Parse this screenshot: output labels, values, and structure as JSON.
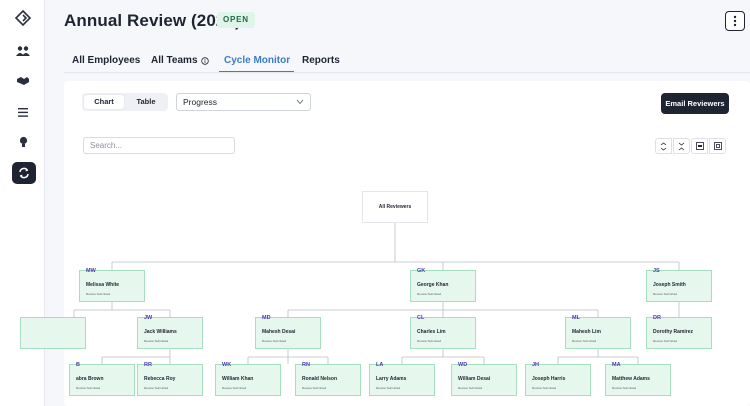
{
  "rail": {
    "items": [
      {
        "name": "logo-icon"
      },
      {
        "name": "people-icon"
      },
      {
        "name": "handshake-icon"
      },
      {
        "name": "list-icon"
      },
      {
        "name": "lightbulb-icon"
      },
      {
        "name": "cycle-icon",
        "active": true
      }
    ]
  },
  "header": {
    "title": "Annual Review (2025)",
    "status": "OPEN"
  },
  "tabs": [
    {
      "label": "All Employees"
    },
    {
      "label": "All Teams"
    },
    {
      "label": "Cycle Monitor",
      "active": true
    },
    {
      "label": "Reports"
    }
  ],
  "toolbar": {
    "view_chart": "Chart",
    "view_table": "Table",
    "select_value": "Progress",
    "email_button": "Email Reviewers",
    "search_placeholder": "Search..."
  },
  "org": {
    "root": {
      "name": "All Reviewers"
    },
    "level1": [
      {
        "initials": "MW",
        "name": "Melissa White",
        "status": "Review Submitted"
      },
      {
        "initials": "GK",
        "name": "George Khan",
        "status": "Review Submitted"
      },
      {
        "initials": "JS",
        "name": "Joseph Smith",
        "status": "Review Submitted"
      }
    ],
    "level2": [
      {
        "initials": "JW",
        "name": "Jack Williams",
        "status": "Review Submitted"
      },
      {
        "initials": "MD",
        "name": "Mahesh Desai",
        "status": "Review Submitted"
      },
      {
        "initials": "CL",
        "name": "Charles Lim",
        "status": "Review Submitted"
      },
      {
        "initials": "ML",
        "name": "Mahesh Lim",
        "status": "Review Submitted"
      },
      {
        "initials": "DR",
        "name": "Dorothy Ramirez",
        "status": "Review Submitted"
      }
    ],
    "level3": [
      {
        "initials": "B",
        "name": "abra Brown",
        "status": "Review Submitted"
      },
      {
        "initials": "RR",
        "name": "Rebecca Roy",
        "status": "Review Submitted"
      },
      {
        "initials": "WK",
        "name": "William Khan",
        "status": "Review Submitted"
      },
      {
        "initials": "RN",
        "name": "Ronald Nelson",
        "status": "Review Submitted"
      },
      {
        "initials": "LA",
        "name": "Larry Adams",
        "status": "Review Submitted"
      },
      {
        "initials": "WD",
        "name": "William Desai",
        "status": "Review Submitted"
      },
      {
        "initials": "JH",
        "name": "Joseph Harris",
        "status": "Review Submitted"
      },
      {
        "initials": "MA",
        "name": "Matthew Adams",
        "status": "Review Submitted"
      }
    ]
  }
}
